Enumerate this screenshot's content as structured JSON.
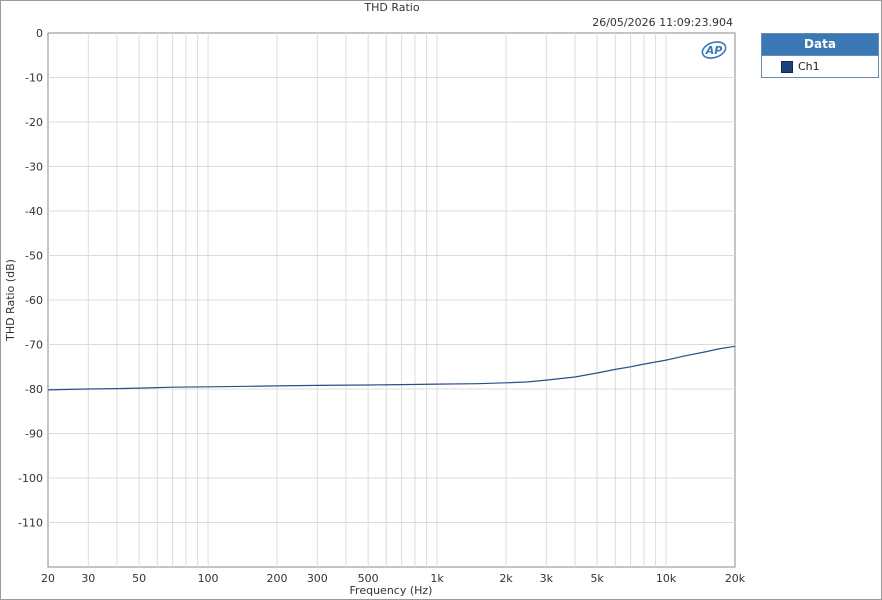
{
  "chart_data": {
    "type": "line",
    "title": "THD Ratio",
    "timestamp": "26/05/2026 11:09:23.904",
    "xlabel": "Frequency (Hz)",
    "ylabel": "THD Ratio (dB)",
    "xscale": "log",
    "xlim": [
      20,
      20000
    ],
    "ylim": [
      -120,
      0
    ],
    "x_ticks": [
      20,
      30,
      50,
      100,
      200,
      300,
      500,
      1000,
      2000,
      3000,
      5000,
      10000,
      20000
    ],
    "x_tick_labels": [
      "20",
      "30",
      "50",
      "100",
      "200",
      "300",
      "500",
      "1k",
      "2k",
      "3k",
      "5k",
      "10k",
      "20k"
    ],
    "y_ticks": [
      0,
      -10,
      -20,
      -30,
      -40,
      -50,
      -60,
      -70,
      -80,
      -90,
      -100,
      -110
    ],
    "y_tick_labels": [
      "0",
      "-10",
      "-20",
      "-30",
      "-40",
      "-50",
      "-60",
      "-70",
      "-80",
      "-90",
      "-100",
      "-110"
    ],
    "grid": true,
    "legend_position": "right",
    "legend_title": "Data",
    "series": [
      {
        "name": "Ch1",
        "color": "#2b4f8a",
        "x": [
          20,
          25,
          30,
          40,
          50,
          70,
          100,
          150,
          200,
          300,
          500,
          700,
          1000,
          1500,
          2000,
          2500,
          3000,
          4000,
          5000,
          6000,
          7000,
          8000,
          10000,
          12000,
          15000,
          17000,
          20000
        ],
        "y": [
          -80.2,
          -80.1,
          -80.0,
          -79.9,
          -79.8,
          -79.6,
          -79.5,
          -79.4,
          -79.3,
          -79.2,
          -79.1,
          -79.0,
          -78.9,
          -78.8,
          -78.6,
          -78.4,
          -78.0,
          -77.3,
          -76.4,
          -75.6,
          -75.0,
          -74.4,
          -73.5,
          -72.6,
          -71.6,
          -71.0,
          -70.4
        ]
      }
    ]
  },
  "logo": {
    "text": "AP",
    "color": "#3a78b6"
  }
}
